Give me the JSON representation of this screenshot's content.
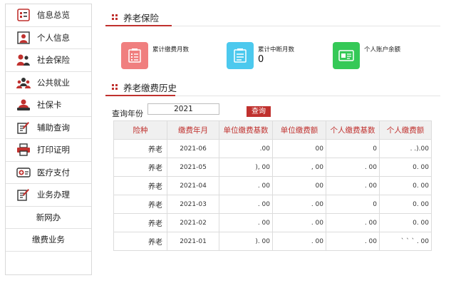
{
  "sidebar": {
    "items": [
      {
        "label": "信息总览",
        "icon": "info-overview-icon"
      },
      {
        "label": "个人信息",
        "icon": "person-icon"
      },
      {
        "label": "社会保险",
        "icon": "people-icon"
      },
      {
        "label": "公共就业",
        "icon": "team-icon"
      },
      {
        "label": "社保卡",
        "icon": "id-card-icon"
      },
      {
        "label": "辅助查询",
        "icon": "edit-icon"
      },
      {
        "label": "打印证明",
        "icon": "printer-icon"
      },
      {
        "label": "医疗支付",
        "icon": "medical-card-icon"
      },
      {
        "label": "业务办理",
        "icon": "edit-icon"
      },
      {
        "label": "新网办"
      },
      {
        "label": "缴费业务"
      }
    ]
  },
  "insurance_section": {
    "title": "养老保险"
  },
  "stats": [
    {
      "label": "累计缴费月数",
      "value": "",
      "color": "#f07f7f",
      "icon": "document-list-icon"
    },
    {
      "label": "累计中断月数",
      "value": "0",
      "color": "#4cc9ee",
      "icon": "document-list-icon"
    },
    {
      "label": "个人账户余额",
      "value": "",
      "color": "#35c957",
      "icon": "account-card-icon"
    }
  ],
  "history_section": {
    "title": "养老缴费历史"
  },
  "query": {
    "label": "查询年份",
    "value": "2021",
    "button": "查询"
  },
  "table": {
    "headers": [
      "险种",
      "缴费年月",
      "单位缴费基数",
      "单位缴费额",
      "个人缴费基数",
      "个人缴费额"
    ],
    "rows": [
      [
        "养老",
        "2021-06",
        ".00",
        "00",
        "0",
        ". .).00"
      ],
      [
        "养老",
        "2021-05",
        "), 00",
        ", 00",
        ". 00",
        "0. 00"
      ],
      [
        "养老",
        "2021-04",
        ". 00",
        "00",
        ". 00",
        "0. 00"
      ],
      [
        "养老",
        "2021-03",
        ". 00",
        ". 00",
        "0",
        "0. 00"
      ],
      [
        "养老",
        "2021-02",
        ". 00",
        ". 00",
        ". 00",
        "0. 00"
      ],
      [
        "养老",
        "2021-01",
        "). 00",
        ". 00",
        ". 00",
        "` ` ` . 00"
      ]
    ]
  },
  "colors": {
    "accent": "#c0312e"
  }
}
